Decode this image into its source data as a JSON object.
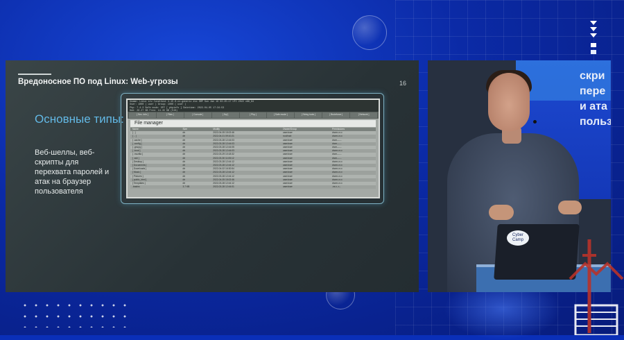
{
  "slide": {
    "title": "Вредоносное ПО под Linux: Web-угрозы",
    "page_number": "16",
    "heading": "Основные типы:",
    "body": "Веб-шеллы, веб-скрипты для перехвата паролей и атак на браузер пользователя",
    "screenshot": {
      "header_lines": [
        "Uname: Linux srv.localhost 4.15.0-xx-generic #xx SMP Sun Jan 16 03:25:17 UTC 2022 x86_64",
        "User: 1000 ( user ) Group: 1000 ( user )",
        "Php: 7.4.3 Safe mode: OFF [ phpinfo ] Datetime: 2022-04-05 17:34:53",
        "Hdd: 28.27 GB Free: 14.45 GB (51%)",
        "Cwd: /home/user/public_html/ drwxr-xr-x [ home ]"
      ],
      "menu": [
        "[ Sec. Info ]",
        "[ Files ]",
        "[ Console ]",
        "[ Sql ]",
        "[ Php ]",
        "[ Safe mode ]",
        "[ String tools ]",
        "[ Bruteforce ]",
        "[ Network ]"
      ],
      "file_manager_label": "File manager",
      "columns": [
        "Name",
        "Size",
        "Modify",
        "Owner/Group",
        "Permissions"
      ],
      "rows": [
        [
          "[ . ]",
          "dir",
          "2022-04-05 15:02:46",
          "user/user",
          "drwxr-xr-x"
        ],
        [
          "[ .. ]",
          "dir",
          "2022-04-01 09:10:21",
          "root/root",
          "drwxr-xr-x"
        ],
        [
          "[ .cache ]",
          "dir",
          "2022-03-28 12:44:03",
          "user/user",
          "drwx------"
        ],
        [
          "[ .config ]",
          "dir",
          "2022-03-28 12:44:03",
          "user/user",
          "drwx------"
        ],
        [
          "[ .gnupg ]",
          "dir",
          "2022-03-28 12:44:05",
          "user/user",
          "drwx------"
        ],
        [
          "[ .local ]",
          "dir",
          "2022-03-28 12:44:03",
          "user/user",
          "drwxr-xr-x"
        ],
        [
          "[ .mozilla ]",
          "dir",
          "2022-03-29 10:18:32",
          "user/user",
          "drwx------"
        ],
        [
          "[ .ssh ]",
          "dir",
          "2022-03-30 11:05:12",
          "user/user",
          "drwx------"
        ],
        [
          "[ Desktop ]",
          "dir",
          "2022-03-28 12:44:12",
          "user/user",
          "drwxr-xr-x"
        ],
        [
          "[ Documents ]",
          "dir",
          "2022-03-28 12:44:12",
          "user/user",
          "drwxr-xr-x"
        ],
        [
          "[ Downloads ]",
          "dir",
          "2022-04-02 16:30:54",
          "user/user",
          "drwxr-xr-x"
        ],
        [
          "[ Music ]",
          "dir",
          "2022-03-28 12:44:12",
          "user/user",
          "drwxr-xr-x"
        ],
        [
          "[ Pictures ]",
          "dir",
          "2022-03-28 12:44:12",
          "user/user",
          "drwxr-xr-x"
        ],
        [
          "[ public_html ]",
          "dir",
          "2022-04-05 15:02:46",
          "user/user",
          "drwxr-xr-x"
        ],
        [
          "[ Templates ]",
          "dir",
          "2022-03-28 12:44:12",
          "user/user",
          "drwxr-xr-x"
        ],
        [
          ".bashrc",
          "3.7 KB",
          "2022-03-28 12:44:01",
          "user/user",
          "-rw-r--r--"
        ]
      ]
    }
  },
  "video": {
    "screen_text": "скри\nпере\nи ата\nпольз",
    "laptop_sticker": "Cyber Camp"
  },
  "colors": {
    "background": "#0b2aa6",
    "slide_bg": "#2c3639",
    "heading": "#63b9e6",
    "accent_red": "#c0392b"
  }
}
